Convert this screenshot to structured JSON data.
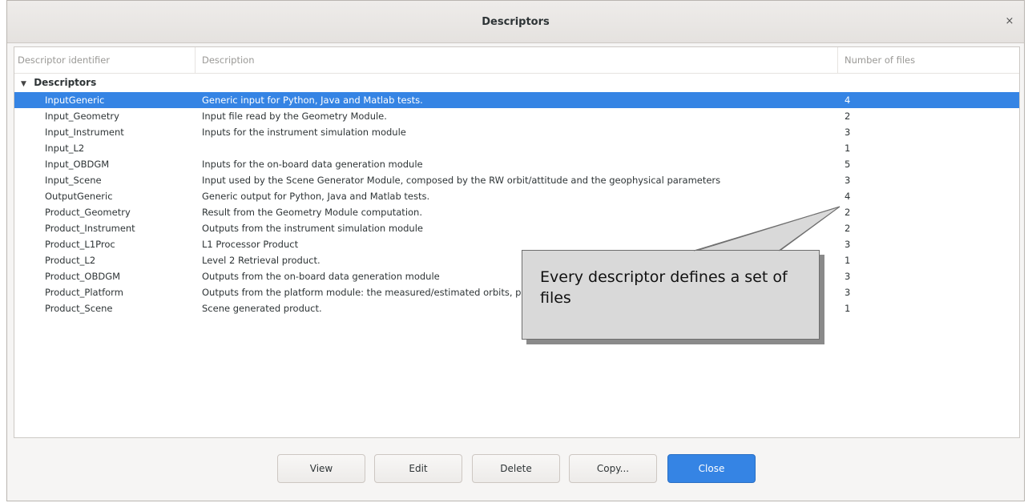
{
  "window": {
    "title": "Descriptors",
    "close_symbol": "×"
  },
  "columns": {
    "identifier": "Descriptor identifier",
    "description": "Description",
    "count": "Number of files"
  },
  "group": {
    "label": "Descriptors",
    "expanded": true
  },
  "rows": [
    {
      "id": "InputGeneric",
      "description": "Generic input for Python, Java and Matlab tests.",
      "count": "4",
      "selected": true
    },
    {
      "id": "Input_Geometry",
      "description": "Input file read by the Geometry Module.",
      "count": "2"
    },
    {
      "id": "Input_Instrument",
      "description": "Inputs for the instrument simulation module",
      "count": "3"
    },
    {
      "id": "Input_L2",
      "description": "",
      "count": "1"
    },
    {
      "id": "Input_OBDGM",
      "description": "Inputs for the on-board data generation module",
      "count": "5"
    },
    {
      "id": "Input_Scene",
      "description": "Input used by the Scene Generator Module, composed by the RW orbit/attitude and the geophysical parameters",
      "count": "3"
    },
    {
      "id": "OutputGeneric",
      "description": "Generic output for Python, Java and Matlab tests.",
      "count": "4"
    },
    {
      "id": "Product_Geometry",
      "description": "Result from the Geometry Module computation.",
      "count": "2"
    },
    {
      "id": "Product_Instrument",
      "description": "Outputs from the instrument simulation module",
      "count": "2"
    },
    {
      "id": "Product_L1Proc",
      "description": "L1 Processor Product",
      "count": "3"
    },
    {
      "id": "Product_L2",
      "description": "Level 2 Retrieval product.",
      "count": "1"
    },
    {
      "id": "Product_OBDGM",
      "description": "Outputs from the on-board data generation module",
      "count": "3"
    },
    {
      "id": "Product_Platform",
      "description": "Outputs from the platform module: the measured/estimated orbits, plus some extra data",
      "count": "3"
    },
    {
      "id": "Product_Scene",
      "description": "Scene generated product.",
      "count": "1"
    }
  ],
  "buttons": {
    "view": "View",
    "edit": "Edit",
    "delete": "Delete",
    "copy": "Copy...",
    "close": "Close"
  },
  "callout": {
    "text": "Every descriptor defines a set of files"
  },
  "colors": {
    "selection": "#3584e4",
    "callout_bg": "#d9d9d9"
  }
}
